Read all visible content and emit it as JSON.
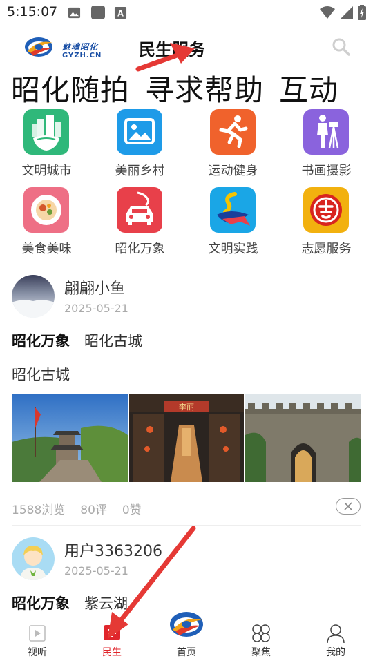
{
  "status_bar": {
    "time": "5:15:07",
    "icons": [
      "image-icon",
      "square-app-icon",
      "text-a-icon",
      "wifi-icon",
      "signal-icon",
      "battery-charging-icon"
    ]
  },
  "header": {
    "logo_title": "魅魂昭化",
    "logo_subtitle": "GYZH.CN",
    "title": "民生服务",
    "search_icon": "search-icon"
  },
  "category_tabs": [
    "昭化随拍",
    "寻求帮助",
    "互动"
  ],
  "services": [
    {
      "label": "文明城市",
      "icon": "city-building-icon",
      "color": "#2fb87a"
    },
    {
      "label": "美丽乡村",
      "icon": "landscape-picture-icon",
      "color": "#1e9be8"
    },
    {
      "label": "运动健身",
      "icon": "runner-icon",
      "color": "#f0622c"
    },
    {
      "label": "书画摄影",
      "icon": "photographer-icon",
      "color": "#8a63dd"
    },
    {
      "label": "美食美味",
      "icon": "food-plate-icon",
      "color": "#ee6f85"
    },
    {
      "label": "昭化万象",
      "icon": "car-map-icon",
      "color": "#e8404a"
    },
    {
      "label": "文明实践",
      "icon": "ribbon-logo-icon",
      "color": "#1aa6e6"
    },
    {
      "label": "志愿服务",
      "icon": "volunteer-badge-icon",
      "color": "#f2b10f"
    }
  ],
  "posts": [
    {
      "user": "翩翩小鱼",
      "date": "2025-05-21",
      "tag": "昭化万象",
      "subtag": "昭化古城",
      "text": "昭化古城",
      "photos": [
        "city-wall-tower-photo",
        "ancient-street-gate-photo",
        "stone-gate-photo"
      ],
      "views": "1588浏览",
      "comments": "80评",
      "likes": "0赞"
    },
    {
      "user": "用户3363206",
      "date": "2025-05-21",
      "tag": "昭化万象",
      "subtag": "紫云湖"
    }
  ],
  "bottom_nav": [
    {
      "label": "视听",
      "icon": "video-icon"
    },
    {
      "label": "民生",
      "icon": "livelihood-icon",
      "active": true
    },
    {
      "label": "首页",
      "icon": "home-logo-icon"
    },
    {
      "label": "聚焦",
      "icon": "focus-grid-icon"
    },
    {
      "label": "我的",
      "icon": "user-profile-icon"
    }
  ],
  "colors": {
    "accent_red": "#e0262c",
    "annotation_arrow": "#e53935",
    "brand_blue": "#1a4fa5"
  }
}
